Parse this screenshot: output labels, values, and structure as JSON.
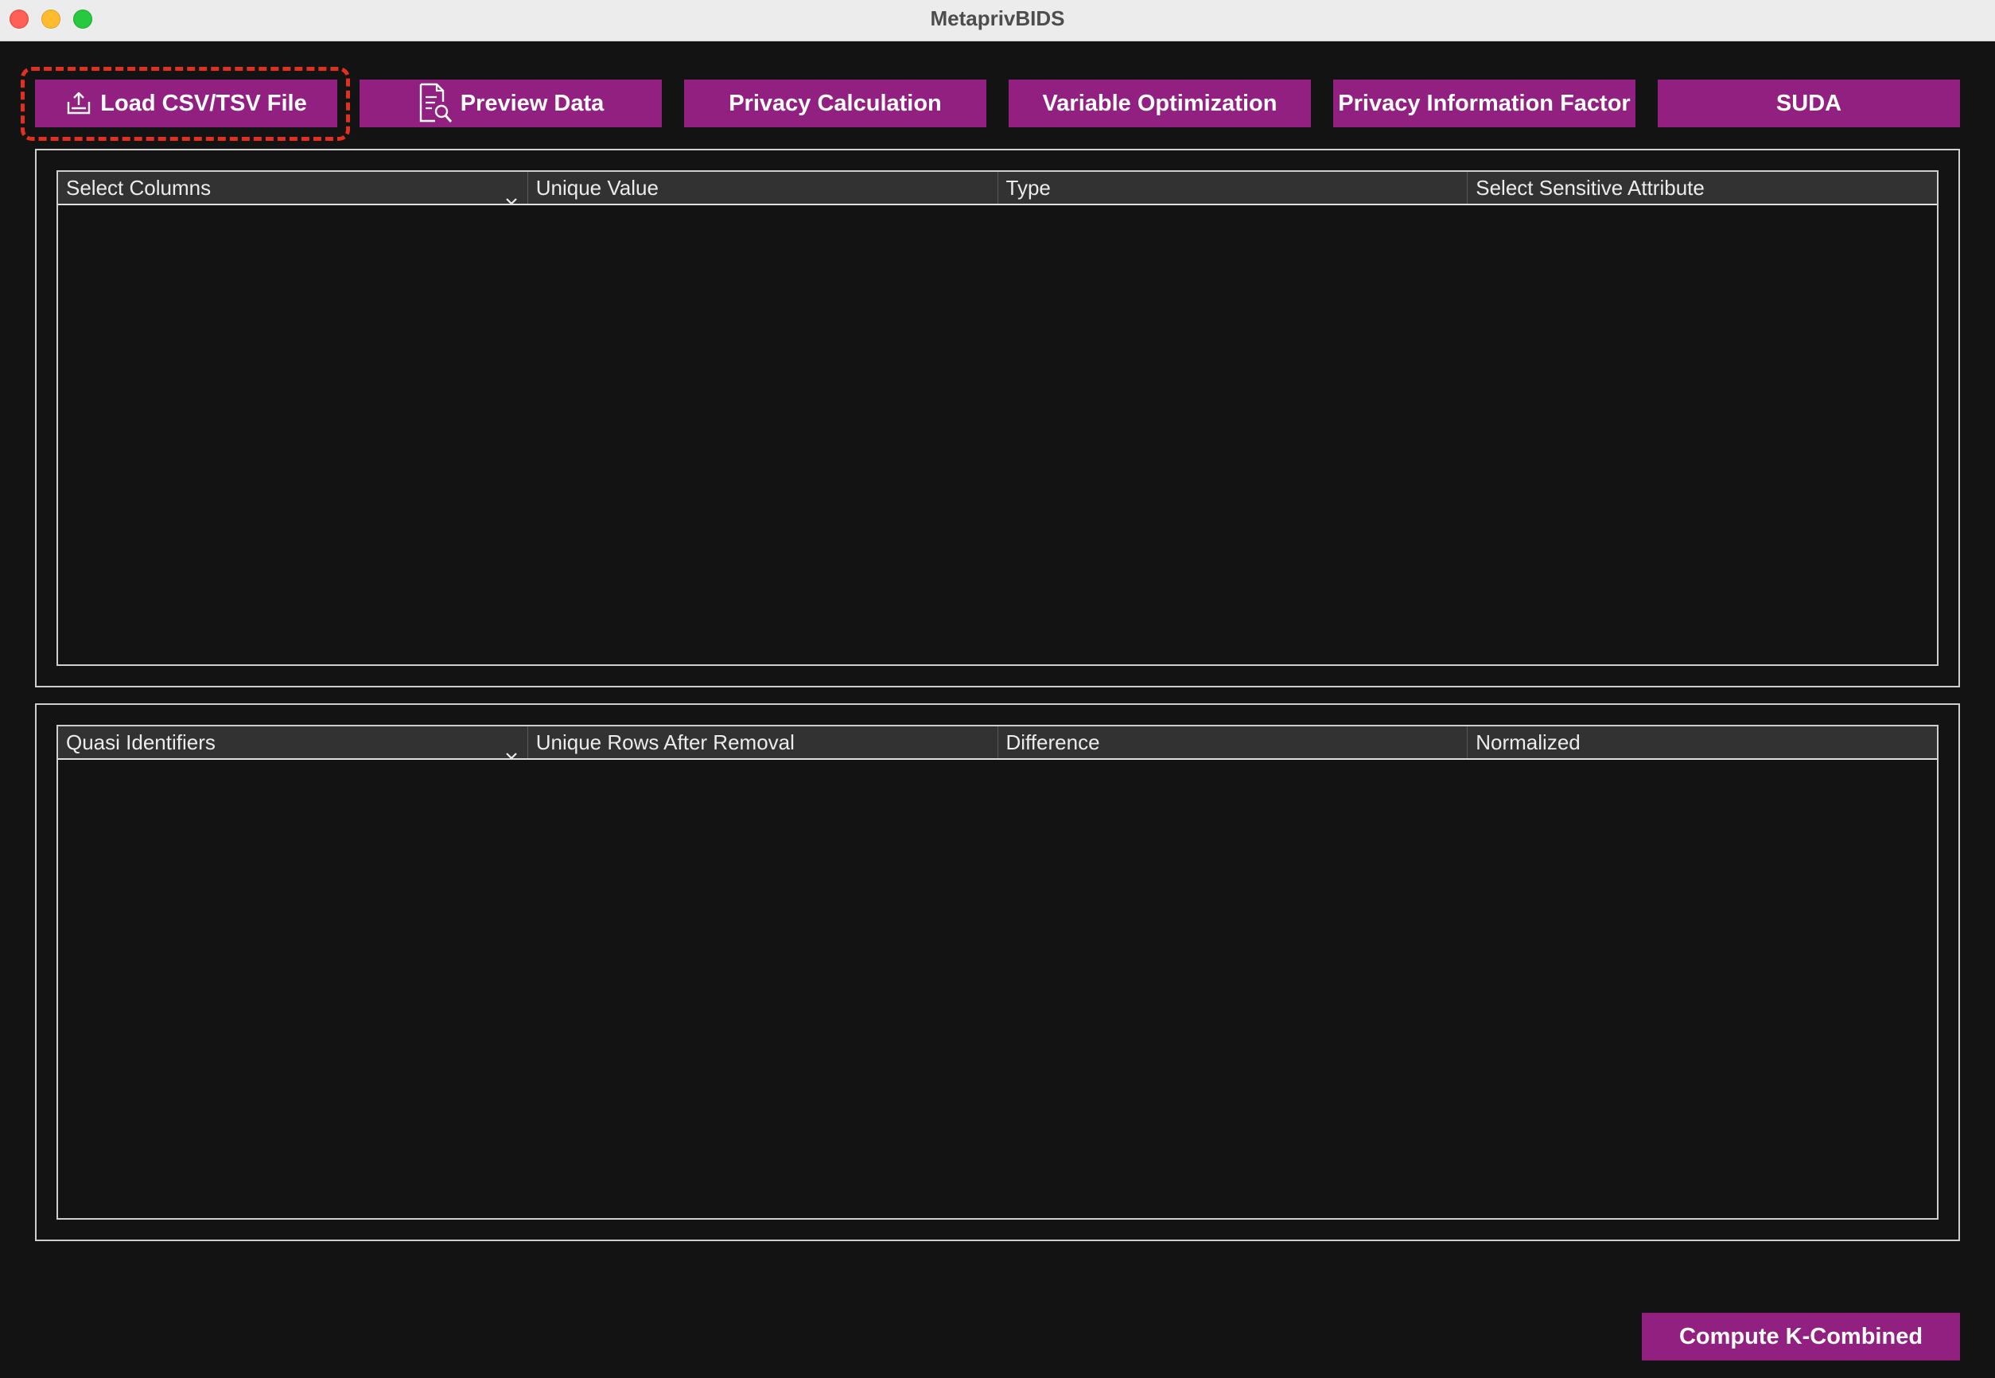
{
  "window": {
    "title": "MetaprivBIDS"
  },
  "toolbar": {
    "buttons": [
      {
        "label": "Load CSV/TSV File",
        "icon": "upload-icon",
        "highlighted": true
      },
      {
        "label": "Preview Data",
        "icon": "document-search-icon"
      },
      {
        "label": "Privacy Calculation"
      },
      {
        "label": "Variable Optimization"
      },
      {
        "label": "Privacy Information Factor"
      },
      {
        "label": "SUDA"
      }
    ]
  },
  "columns_table": {
    "headers": [
      "Select Columns",
      "Unique Value",
      "Type",
      "Select Sensitive Attribute"
    ],
    "rows": []
  },
  "quasi_table": {
    "headers": [
      "Quasi Identifiers",
      "Unique Rows After Removal",
      "Difference",
      "Normalized"
    ],
    "rows": []
  },
  "footer": {
    "compute_label": "Compute K-Combined"
  },
  "colors": {
    "accent": "#922080",
    "background": "#131313",
    "highlight": "#e0301e"
  }
}
